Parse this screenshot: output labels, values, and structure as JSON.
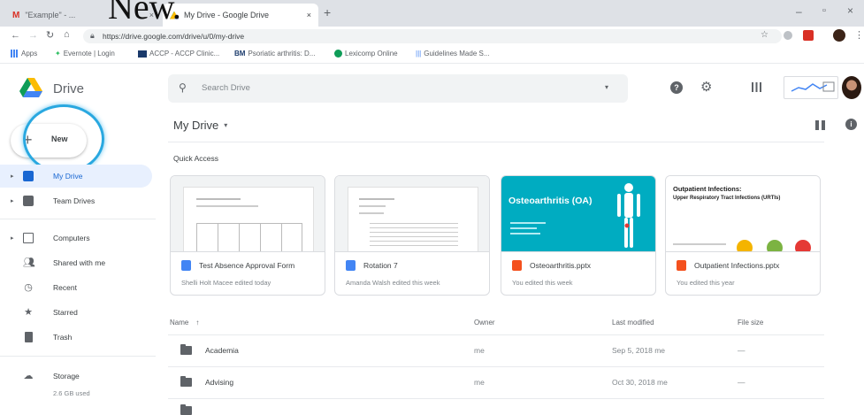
{
  "annotation": "New.",
  "browser": {
    "tabs": [
      {
        "label": "\"Example\" - ..."
      },
      {
        "label": "My Drive - Google Drive"
      }
    ],
    "new_tab": "+",
    "url": "https://drive.google.com/drive/u/0/my-drive",
    "bookmarks": [
      "Apps",
      "Evernote | Login",
      "ACCP - ACCP Clinic...",
      "Psoriatic arthritis: D...",
      "Lexicomp Online",
      "Guidelines Made S..."
    ]
  },
  "drive": {
    "product_name": "Drive",
    "search_placeholder": "Search Drive",
    "new_label": "New",
    "page_title": "My Drive",
    "quick_access_label": "Quick Access",
    "nav": [
      {
        "label": "My Drive",
        "icon": "drive-icon"
      },
      {
        "label": "Team Drives",
        "icon": "team-drives-icon"
      },
      {
        "label": "Computers",
        "icon": "computer-icon"
      },
      {
        "label": "Shared with me",
        "icon": "people-icon"
      },
      {
        "label": "Recent",
        "icon": "clock-icon"
      },
      {
        "label": "Starred",
        "icon": "star-icon"
      },
      {
        "label": "Trash",
        "icon": "trash-icon"
      },
      {
        "label": "Storage",
        "icon": "cloud-icon"
      }
    ],
    "storage_used": "2.6 GB used",
    "quick_access": [
      {
        "title": "Test Absence Approval Form",
        "subtitle": "Shelli Holt Macee edited today",
        "type": "doc"
      },
      {
        "title": "Rotation 7",
        "subtitle": "Amanda Walsh edited this week",
        "type": "doc"
      },
      {
        "title": "Osteoarthritis.pptx",
        "subtitle": "You edited this week",
        "type": "slides",
        "thumb_heading": "Osteoarthritis (OA)"
      },
      {
        "title": "Outpatient Infections.pptx",
        "subtitle": "You edited this year",
        "type": "slides",
        "thumb_heading": "Outpatient Infections:",
        "thumb_subheading": "Upper Respiratory Tract Infections (URTIs)"
      }
    ],
    "table": {
      "headers": [
        "Name",
        "Owner",
        "Last modified",
        "File size"
      ],
      "rows": [
        {
          "name": "Academia",
          "owner": "me",
          "modified": "Sep 5, 2018 me",
          "size": "—"
        },
        {
          "name": "Advising",
          "owner": "me",
          "modified": "Oct 30, 2018 me",
          "size": "—"
        }
      ]
    },
    "colors": {
      "accent": "#1a73e8",
      "highlight_circle": "#29a8e0",
      "doc": "#4285f4",
      "slides": "#f4b400",
      "teal": "#00acc1"
    }
  }
}
